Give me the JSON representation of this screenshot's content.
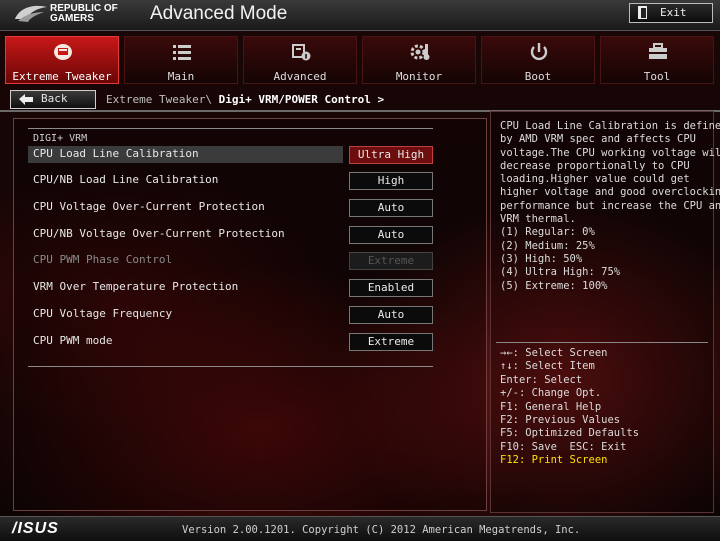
{
  "header": {
    "brand_line1": "REPUBLIC OF",
    "brand_line2": "GAMERS",
    "mode_title": "Advanced Mode",
    "exit_label": "Exit"
  },
  "tabs": [
    {
      "label": "Extreme Tweaker",
      "icon": "rog-eye-icon",
      "active": true
    },
    {
      "label": "Main",
      "icon": "list-icon",
      "active": false
    },
    {
      "label": "Advanced",
      "icon": "chip-info-icon",
      "active": false
    },
    {
      "label": "Monitor",
      "icon": "gear-thermometer-icon",
      "active": false
    },
    {
      "label": "Boot",
      "icon": "power-icon",
      "active": false
    },
    {
      "label": "Tool",
      "icon": "toolbox-icon",
      "active": false
    }
  ],
  "breadcrumb": {
    "back_label": "Back",
    "path": "Extreme Tweaker\\",
    "current": "Digi+ VRM/POWER Control >"
  },
  "section": {
    "label": "DIGI+ VRM"
  },
  "settings": [
    {
      "name": "CPU Load Line Calibration",
      "value": "Ultra High",
      "selected": true,
      "disabled": false
    },
    {
      "name": "CPU/NB Load Line Calibration",
      "value": "High",
      "selected": false,
      "disabled": false
    },
    {
      "name": "CPU Voltage Over-Current Protection",
      "value": "Auto",
      "selected": false,
      "disabled": false
    },
    {
      "name": "CPU/NB Voltage Over-Current Protection",
      "value": "Auto",
      "selected": false,
      "disabled": false
    },
    {
      "name": "CPU PWM Phase Control",
      "value": "Extreme",
      "selected": false,
      "disabled": true
    },
    {
      "name": "VRM Over Temperature Protection",
      "value": "Enabled",
      "selected": false,
      "disabled": false
    },
    {
      "name": "CPU Voltage Frequency",
      "value": "Auto",
      "selected": false,
      "disabled": false
    },
    {
      "name": "CPU PWM mode",
      "value": "Extreme",
      "selected": false,
      "disabled": false
    }
  ],
  "help": {
    "description": "CPU Load Line Calibration is defined\nby AMD VRM spec and affects CPU\nvoltage.The CPU working voltage will\ndecrease proportionally to CPU\nloading.Higher value could get\nhigher voltage and good overclocking\nperformance but increase the CPU and\nVRM thermal.\n(1) Regular: 0%\n(2) Medium: 25%\n(3) High: 50%\n(4) Ultra High: 75%\n(5) Extreme: 100%"
  },
  "keys": [
    "→←: Select Screen",
    "↑↓: Select Item",
    "Enter: Select",
    "+/-: Change Opt.",
    "F1: General Help",
    "F2: Previous Values",
    "F5: Optimized Defaults",
    "F10: Save  ESC: Exit",
    "F12: Print Screen"
  ],
  "footer": {
    "brand": "/ISUS",
    "version": "Version 2.00.1201. Copyright (C) 2012 American Megatrends, Inc."
  },
  "colors": {
    "accent_red": "#c71818",
    "hotkey_yellow": "#ffe000",
    "selected_value_bg": "#6e0d0d"
  }
}
